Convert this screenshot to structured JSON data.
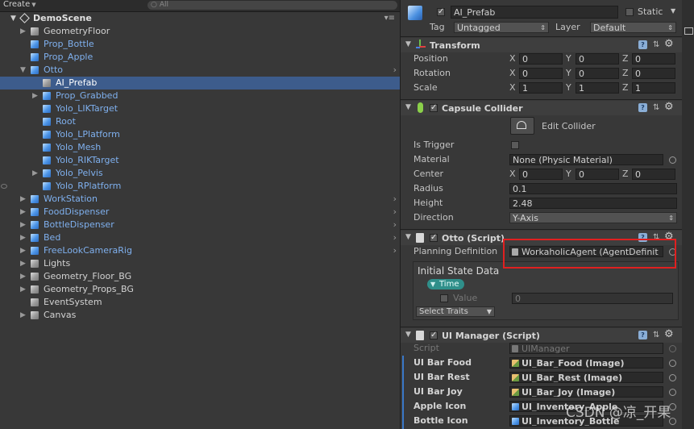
{
  "hierarchy": {
    "create_label": "Create",
    "search_placeholder": "All",
    "scene_name": "DemoScene",
    "items": [
      {
        "label": "GeometryFloor",
        "depth": 1,
        "fold": true,
        "prefab": false
      },
      {
        "label": "Prop_Bottle",
        "depth": 1,
        "fold": false,
        "prefab": true
      },
      {
        "label": "Prop_Apple",
        "depth": 1,
        "fold": false,
        "prefab": true
      },
      {
        "label": "Otto",
        "depth": 1,
        "fold": "open",
        "prefab": true,
        "chevron": true
      },
      {
        "label": "AI_Prefab",
        "depth": 2,
        "fold": false,
        "prefab": false,
        "selected": true
      },
      {
        "label": "Prop_Grabbed",
        "depth": 2,
        "fold": true,
        "prefab": true
      },
      {
        "label": "Yolo_LIKTarget",
        "depth": 2,
        "fold": false,
        "prefab": true
      },
      {
        "label": "Root",
        "depth": 2,
        "fold": false,
        "prefab": true
      },
      {
        "label": "Yolo_LPlatform",
        "depth": 2,
        "fold": false,
        "prefab": true
      },
      {
        "label": "Yolo_Mesh",
        "depth": 2,
        "fold": false,
        "prefab": true
      },
      {
        "label": "Yolo_RIKTarget",
        "depth": 2,
        "fold": false,
        "prefab": true
      },
      {
        "label": "Yolo_Pelvis",
        "depth": 2,
        "fold": true,
        "prefab": true
      },
      {
        "label": "Yolo_RPlatform",
        "depth": 2,
        "fold": false,
        "prefab": true
      },
      {
        "label": "WorkStation",
        "depth": 1,
        "fold": true,
        "prefab": true,
        "chevron": true
      },
      {
        "label": "FoodDispenser",
        "depth": 1,
        "fold": true,
        "prefab": true,
        "chevron": true
      },
      {
        "label": "BottleDispenser",
        "depth": 1,
        "fold": true,
        "prefab": true,
        "chevron": true
      },
      {
        "label": "Bed",
        "depth": 1,
        "fold": true,
        "prefab": true,
        "chevron": true
      },
      {
        "label": "FreeLookCameraRig",
        "depth": 1,
        "fold": true,
        "prefab": true,
        "chevron": true
      },
      {
        "label": "Lights",
        "depth": 1,
        "fold": true,
        "prefab": false
      },
      {
        "label": "Geometry_Floor_BG",
        "depth": 1,
        "fold": true,
        "prefab": false
      },
      {
        "label": "Geometry_Props_BG",
        "depth": 1,
        "fold": true,
        "prefab": false
      },
      {
        "label": "EventSystem",
        "depth": 1,
        "fold": false,
        "prefab": false
      },
      {
        "label": "Canvas",
        "depth": 1,
        "fold": true,
        "prefab": false
      }
    ]
  },
  "inspector": {
    "object_name": "AI_Prefab",
    "static_label": "Static",
    "tag_label": "Tag",
    "tag_value": "Untagged",
    "layer_label": "Layer",
    "layer_value": "Default",
    "transform": {
      "title": "Transform",
      "position_label": "Position",
      "rotation_label": "Rotation",
      "scale_label": "Scale",
      "x": "X",
      "y": "Y",
      "z": "Z",
      "position": [
        "0",
        "0",
        "0"
      ],
      "rotation": [
        "0",
        "0",
        "0"
      ],
      "scale": [
        "1",
        "1",
        "1"
      ]
    },
    "capsule": {
      "title": "Capsule Collider",
      "edit_label": "Edit Collider",
      "is_trigger_label": "Is Trigger",
      "material_label": "Material",
      "material_value": "None (Physic Material)",
      "center_label": "Center",
      "center": [
        "0",
        "0",
        "0"
      ],
      "radius_label": "Radius",
      "radius_value": "0.1",
      "height_label": "Height",
      "height_value": "2.48",
      "direction_label": "Direction",
      "direction_value": "Y-Axis"
    },
    "otto": {
      "title": "Otto (Script)",
      "planning_label": "Planning Definition",
      "planning_value": "WorkaholicAgent (AgentDefinit",
      "initial_state_label": "Initial State Data",
      "time_label": "Time",
      "value_label": "Value",
      "value_value": "0",
      "select_traits_label": "Select Traits"
    },
    "ui_manager": {
      "title": "UI Manager (Script)",
      "script_label": "Script",
      "script_value": "UIManager",
      "rows": [
        {
          "label": "UI Bar Food",
          "value": "UI_Bar_Food (Image)",
          "icon": "image"
        },
        {
          "label": "UI Bar Rest",
          "value": "UI_Bar_Rest (Image)",
          "icon": "image"
        },
        {
          "label": "UI Bar Joy",
          "value": "UI_Bar_Joy (Image)",
          "icon": "image"
        },
        {
          "label": "Apple Icon",
          "value": "UI_Inventory_Apple",
          "icon": "prefab"
        },
        {
          "label": "Bottle Icon",
          "value": "UI_Inventory_Bottle",
          "icon": "prefab"
        }
      ]
    },
    "help_glyph": "?",
    "preset_glyph": "⇅",
    "gear_glyph": "⚙",
    "watermark": "CSDN @凉_开果"
  },
  "colors": {
    "selection": "#3d5c8c",
    "prefab_text": "#7fb0ee",
    "highlight_box": "#e02020",
    "time_pill": "#2f8f8a"
  }
}
